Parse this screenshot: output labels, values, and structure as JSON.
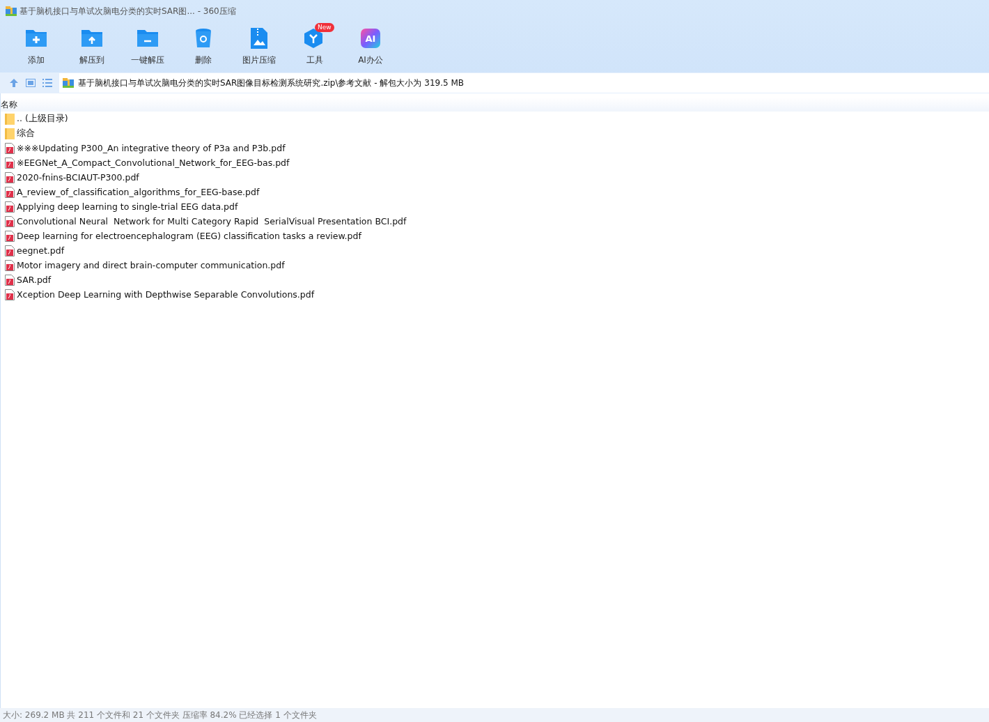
{
  "window": {
    "title": "基于脑机接口与单试次脑电分类的实时SAR图... - 360压缩"
  },
  "toolbar": [
    {
      "kind": "add",
      "label": "添加"
    },
    {
      "kind": "extract",
      "label": "解压到"
    },
    {
      "kind": "oneclick",
      "label": "一键解压"
    },
    {
      "kind": "delete",
      "label": "删除"
    },
    {
      "kind": "image",
      "label": "图片压缩"
    },
    {
      "kind": "tools",
      "label": "工具",
      "badge": "New"
    },
    {
      "kind": "ai",
      "label": "AI办公",
      "logo_text": "AI"
    }
  ],
  "address_bar": {
    "path": "基于脑机接口与单试次脑电分类的实时SAR图像目标检测系统研究.zip\\参考文献 - 解包大小为 319.5 MB"
  },
  "table": {
    "columns": [
      "名称"
    ],
    "rows": [
      {
        "kind": "folder",
        "name": ".. (上级目录)"
      },
      {
        "kind": "folder",
        "name": "综合"
      },
      {
        "kind": "pdf",
        "name": "※※※Updating P300_An integrative theory of P3a and P3b.pdf"
      },
      {
        "kind": "pdf",
        "name": "※EEGNet_A_Compact_Convolutional_Network_for_EEG-bas.pdf"
      },
      {
        "kind": "pdf",
        "name": "2020-fnins-BCIAUT-P300.pdf"
      },
      {
        "kind": "pdf",
        "name": "A_review_of_classification_algorithms_for_EEG-base.pdf"
      },
      {
        "kind": "pdf",
        "name": "Applying deep learning to single-trial EEG data.pdf"
      },
      {
        "kind": "pdf",
        "name": "Convolutional Neural  Network for Multi Category Rapid  SerialVisual Presentation BCI.pdf"
      },
      {
        "kind": "pdf",
        "name": "Deep learning for electroencephalogram (EEG) classification tasks a review.pdf"
      },
      {
        "kind": "pdf",
        "name": "eegnet.pdf"
      },
      {
        "kind": "pdf",
        "name": "Motor imagery and direct brain-computer communication.pdf"
      },
      {
        "kind": "pdf",
        "name": "SAR.pdf"
      },
      {
        "kind": "pdf",
        "name": "Xception Deep Learning with Depthwise Separable Convolutions.pdf"
      }
    ]
  },
  "status_bar": "大小: 269.2 MB 共 211 个文件和 21 个文件夹 压缩率 84.2% 已经选择 1 个文件夹"
}
